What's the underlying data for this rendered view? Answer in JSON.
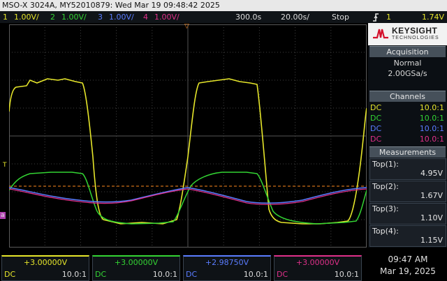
{
  "title_bar": "MSO-X 3024A, MY52010879: Wed Mar 19 09:48:42 2025",
  "status": {
    "ch1_num": "1",
    "ch1_scale": "1.00V/",
    "ch2_num": "2",
    "ch2_scale": "1.00V/",
    "ch3_num": "3",
    "ch3_scale": "1.00V/",
    "ch4_num": "4",
    "ch4_scale": "1.00V/",
    "time_delay": "300.0s",
    "time_scale": "20.00s/",
    "run_state": "Stop",
    "trigger_icon": "rising-edge",
    "trigger_source": "1",
    "trigger_level": "1.74V"
  },
  "brand": {
    "name": "KEYSIGHT",
    "sub": "TECHNOLOGIES"
  },
  "acquisition": {
    "header": "Acquisition",
    "mode": "Normal",
    "rate": "2.00GSa/s"
  },
  "channels_panel": {
    "header": "Channels",
    "rows": [
      {
        "coupling": "DC",
        "probe": "10.0:1"
      },
      {
        "coupling": "DC",
        "probe": "10.0:1"
      },
      {
        "coupling": "DC",
        "probe": "10.0:1"
      },
      {
        "coupling": "DC",
        "probe": "10.0:1"
      }
    ]
  },
  "measurements": {
    "header": "Measurements",
    "items": [
      {
        "label": "Top(1):",
        "value": "4.95V"
      },
      {
        "label": "Top(2):",
        "value": "1.67V"
      },
      {
        "label": "Top(3):",
        "value": "1.10V"
      },
      {
        "label": "Top(4):",
        "value": "1.15V"
      }
    ]
  },
  "bottom_channels": [
    {
      "offset": "+3.00000V",
      "coupling": "DC",
      "probe": "10.0:1"
    },
    {
      "offset": "+3.00000V",
      "coupling": "DC",
      "probe": "10.0:1"
    },
    {
      "offset": "+2.98750V",
      "coupling": "DC",
      "probe": "10.0:1"
    },
    {
      "offset": "+3.00000V",
      "coupling": "DC",
      "probe": "10.0:1"
    }
  ],
  "clock": {
    "time": "09:47 AM",
    "date": "Mar 19, 2025"
  },
  "colors": {
    "ch1": "#e6e62a",
    "ch2": "#33d433",
    "ch3": "#5a7cff",
    "ch4": "#e0308a",
    "trigger_marker": "#ff8a1e",
    "grid": "#404040"
  },
  "screen_markers": {
    "trigger_label": "T",
    "ground_label": "a"
  }
}
